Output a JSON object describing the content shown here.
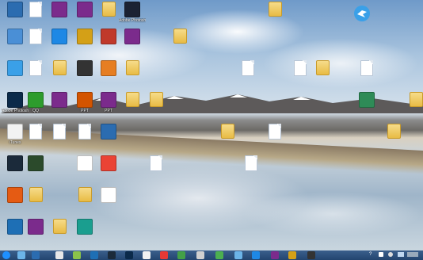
{
  "desktop": {
    "icons": [
      {
        "label": "",
        "kind": "app",
        "color": "#2b6cb0"
      },
      {
        "label": "",
        "kind": "doc",
        "color": "#ffffff"
      },
      {
        "label": "",
        "kind": "app",
        "color": "#7b2b8c"
      },
      {
        "label": "",
        "kind": "app",
        "color": "#7b2b8c"
      },
      {
        "label": "",
        "kind": "folder",
        "color": "#e8bb45"
      },
      {
        "label": "Adobe Photosh...",
        "kind": "app",
        "color": "#1b2233"
      },
      {
        "label": "",
        "kind": "folder",
        "color": "#e8bb45"
      },
      {
        "label": "",
        "kind": "app",
        "color": "#4a8fd6"
      },
      {
        "label": "",
        "kind": "doc",
        "color": "#ffffff"
      },
      {
        "label": "",
        "kind": "app",
        "color": "#1e88e5"
      },
      {
        "label": "",
        "kind": "app",
        "color": "#d4a017"
      },
      {
        "label": "",
        "kind": "app",
        "color": "#c0392b"
      },
      {
        "label": "",
        "kind": "app",
        "color": "#7b2b8c"
      },
      {
        "label": "",
        "kind": "folder",
        "color": "#e8bb45"
      },
      {
        "label": "",
        "kind": "app",
        "color": "#3aa0e8"
      },
      {
        "label": "",
        "kind": "doc",
        "color": "#ffffff"
      },
      {
        "label": "",
        "kind": "folder",
        "color": "#e8bb45"
      },
      {
        "label": "",
        "kind": "app",
        "color": "#333333"
      },
      {
        "label": "",
        "kind": "app",
        "color": "#e67e22"
      },
      {
        "label": "",
        "kind": "folder",
        "color": "#e8bb45"
      },
      {
        "label": "",
        "kind": "doc",
        "color": "#ffffff"
      },
      {
        "label": "",
        "kind": "doc",
        "color": "#ffffff"
      },
      {
        "label": "",
        "kind": "folder",
        "color": "#e8bb45"
      },
      {
        "label": "",
        "kind": "doc",
        "color": "#ffffff"
      },
      {
        "label": "Adobe Photosh...",
        "kind": "app",
        "color": "#0b2a4a"
      },
      {
        "label": "QQ",
        "kind": "app",
        "color": "#2d9c2d"
      },
      {
        "label": "",
        "kind": "app",
        "color": "#7b2b8c"
      },
      {
        "label": "PPT",
        "kind": "app",
        "color": "#d35400"
      },
      {
        "label": "PPT",
        "kind": "app",
        "color": "#7b2b8c"
      },
      {
        "label": "",
        "kind": "folder",
        "color": "#e8bb45"
      },
      {
        "label": "",
        "kind": "folder",
        "color": "#e8bb45"
      },
      {
        "label": "",
        "kind": "app",
        "color": "#2e8b57"
      },
      {
        "label": "",
        "kind": "folder",
        "color": "#e8bb45"
      },
      {
        "label": "iTunes",
        "kind": "app",
        "color": "#f2f2f2"
      },
      {
        "label": "",
        "kind": "doc",
        "color": "#ffffff"
      },
      {
        "label": "",
        "kind": "doc",
        "color": "#ffffff"
      },
      {
        "label": "",
        "kind": "doc",
        "color": "#ffffff"
      },
      {
        "label": "",
        "kind": "app",
        "color": "#2b6cb0"
      },
      {
        "label": "",
        "kind": "folder",
        "color": "#e8bb45"
      },
      {
        "label": "",
        "kind": "doc",
        "color": "#ffffff"
      },
      {
        "label": "",
        "kind": "folder",
        "color": "#e8bb45"
      },
      {
        "label": "",
        "kind": "app",
        "color": "#1b2a3a"
      },
      {
        "label": "",
        "kind": "app",
        "color": "#2b4a2b"
      },
      {
        "label": "",
        "kind": "app",
        "color": "#ffffff"
      },
      {
        "label": "",
        "kind": "app",
        "color": "#ea4335"
      },
      {
        "label": "",
        "kind": "doc",
        "color": "#ffffff"
      },
      {
        "label": "",
        "kind": "doc",
        "color": "#ffffff"
      },
      {
        "label": "",
        "kind": "app",
        "color": "#e55b13"
      },
      {
        "label": "",
        "kind": "folder",
        "color": "#e8bb45"
      },
      {
        "label": "",
        "kind": "folder",
        "color": "#e8bb45"
      },
      {
        "label": "",
        "kind": "app",
        "color": "#ffffff"
      },
      {
        "label": "",
        "kind": "app",
        "color": "#1e6fb5"
      },
      {
        "label": "",
        "kind": "app",
        "color": "#7b2b8c"
      },
      {
        "label": "",
        "kind": "folder",
        "color": "#e8bb45"
      },
      {
        "label": "",
        "kind": "app",
        "color": "#1a9e8f"
      }
    ]
  },
  "taskbar": {
    "items": [
      {
        "name": "start",
        "color": "#1e90ff"
      },
      {
        "name": "app",
        "color": "#6cb4e8"
      },
      {
        "name": "app",
        "color": "#2b6cb0"
      },
      {
        "name": "app",
        "color": "#e8e8e8"
      },
      {
        "name": "app",
        "color": "#8bc34a"
      },
      {
        "name": "app",
        "color": "#1e6fb5"
      },
      {
        "name": "app",
        "color": "#1b2a3a"
      },
      {
        "name": "app",
        "color": "#0b2a4a"
      },
      {
        "name": "app",
        "color": "#f2f2f2"
      },
      {
        "name": "app",
        "color": "#e53935"
      },
      {
        "name": "app",
        "color": "#43a047"
      },
      {
        "name": "app",
        "color": "#d0d0d0"
      },
      {
        "name": "app",
        "color": "#4caf50"
      },
      {
        "name": "app",
        "color": "#6cb4e8"
      },
      {
        "name": "app",
        "color": "#1e88e5"
      },
      {
        "name": "app",
        "color": "#7b2b8c"
      },
      {
        "name": "app",
        "color": "#d4a017"
      },
      {
        "name": "app",
        "color": "#333333"
      }
    ],
    "tray_text": "?"
  },
  "wallpaper": {
    "accent": "#6f9ac9"
  }
}
